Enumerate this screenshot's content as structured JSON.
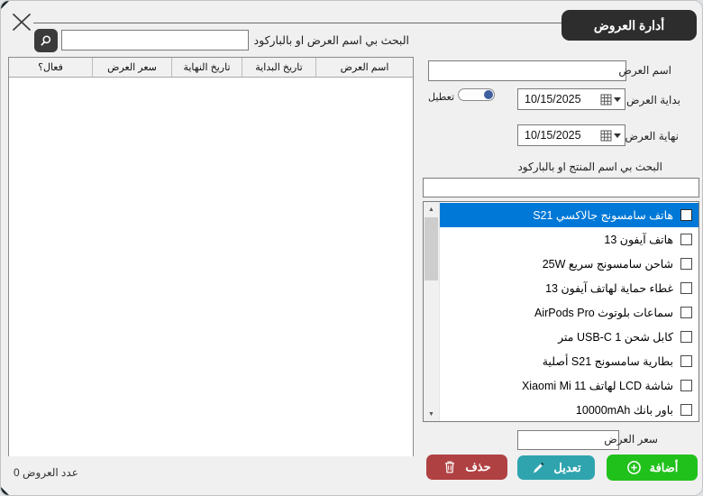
{
  "header": {
    "title": "أدارة العروض"
  },
  "top_search": {
    "label": "البحث بي اسم العرض او بالباركود",
    "value": "",
    "button_icon": "magnifier-icon"
  },
  "table": {
    "columns": [
      "اسم العرض",
      "تاريخ البداية",
      "تاريخ النهاية",
      "سعر العرض",
      "فعال؟"
    ],
    "rows": [],
    "count_label": "عدد العروض 0"
  },
  "form": {
    "offer_name": {
      "label": "اسم العرض",
      "value": ""
    },
    "disable_toggle": {
      "label": "تعطيل",
      "state": "on"
    },
    "start_date": {
      "label": "بداية العرض",
      "value": "10/15/2025"
    },
    "end_date": {
      "label": "نهاية العرض",
      "value": "10/15/2025"
    },
    "product_search": {
      "label": "البحث بي اسم المنتج او بالباركود",
      "value": ""
    },
    "products": [
      {
        "name": "هاتف سامسونج جالاكسي S21",
        "checked": false,
        "selected": true
      },
      {
        "name": "هاتف آيفون 13",
        "checked": false,
        "selected": false
      },
      {
        "name": "شاحن سامسونج سريع 25W",
        "checked": false,
        "selected": false
      },
      {
        "name": "غطاء حماية لهاتف آيفون 13",
        "checked": false,
        "selected": false
      },
      {
        "name": "سماعات بلوتوث AirPods Pro",
        "checked": false,
        "selected": false
      },
      {
        "name": "كابل شحن USB-C 1 متر",
        "checked": false,
        "selected": false
      },
      {
        "name": "بطارية سامسونج S21 أصلية",
        "checked": false,
        "selected": false
      },
      {
        "name": "شاشة LCD لهاتف Xiaomi Mi 11",
        "checked": false,
        "selected": false
      },
      {
        "name": "باور بانك 10000mAh",
        "checked": false,
        "selected": false
      }
    ],
    "offer_price": {
      "label": "سعر العرض",
      "value": ""
    },
    "buttons": {
      "add": "أضافة",
      "edit": "تعديل",
      "delete": "حذف"
    }
  },
  "colors": {
    "selection_blue": "#0078d7",
    "add_green": "#21c11c",
    "edit_teal": "#2fa4ae",
    "delete_red": "#b04143",
    "badge_dark": "#2d2d2d",
    "toggle_knob_blue": "#3f5f9e"
  }
}
